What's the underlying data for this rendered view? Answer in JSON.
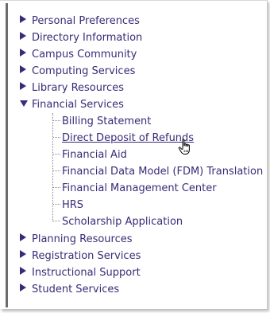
{
  "tree": {
    "top_items": [
      {
        "label": "Personal Preferences"
      },
      {
        "label": "Directory Information"
      },
      {
        "label": "Campus Community"
      },
      {
        "label": "Computing Services"
      },
      {
        "label": "Library Resources"
      }
    ],
    "expanded_item": {
      "label": "Financial Services",
      "children": [
        {
          "label": "Billing Statement"
        },
        {
          "label": "Direct Deposit of Refunds"
        },
        {
          "label": "Financial Aid"
        },
        {
          "label": "Financial Data Model (FDM) Translation"
        },
        {
          "label": "Financial Management Center"
        },
        {
          "label": "HRS"
        },
        {
          "label": "Scholarship Application"
        }
      ]
    },
    "bottom_items": [
      {
        "label": "Planning Resources"
      },
      {
        "label": "Registration Services"
      },
      {
        "label": "Instructional Support"
      },
      {
        "label": "Student Services"
      }
    ]
  },
  "colors": {
    "link": "#3b2a78",
    "left_bar": "#6c6c6c",
    "connector": "#888888"
  },
  "icons": {
    "collapsed": "triangle-right-icon",
    "expanded": "triangle-down-icon",
    "cursor": "hand-pointer-icon"
  }
}
